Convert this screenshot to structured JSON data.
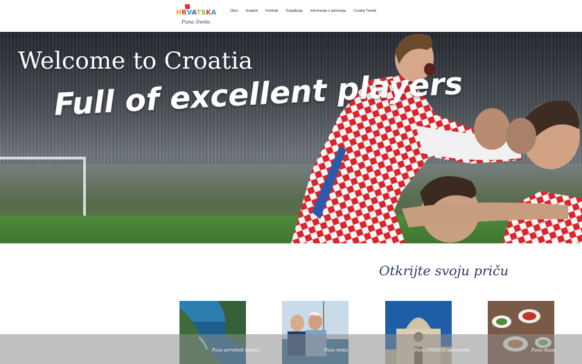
{
  "header": {
    "logo": {
      "word": [
        "H",
        "R",
        "V",
        "A",
        "T",
        "S",
        "K",
        "A"
      ],
      "tagline": "Puna života"
    },
    "nav": [
      "Otoci",
      "Gradovi",
      "Festivali",
      "Događanja",
      "Informacije o putovanju",
      "Croatia Trends"
    ]
  },
  "hero": {
    "title": "Welcome to Croatia",
    "subtitle": "Full of excellent players"
  },
  "discover": {
    "title": "Otkrijte svoju priču",
    "cards": [
      {
        "label": "Puna prirodnih ljepota",
        "scene": "coastline"
      },
      {
        "label": "Puna otoka",
        "scene": "sailors"
      },
      {
        "label": "Puna UNESCO spomenika",
        "scene": "cathedral"
      },
      {
        "label": "Puna okusa",
        "scene": "food-table"
      }
    ]
  },
  "colors": {
    "brand_navy": "#2a3a5c",
    "checker_red": "#d8262c",
    "pitch_green": "#4f8a3c"
  }
}
